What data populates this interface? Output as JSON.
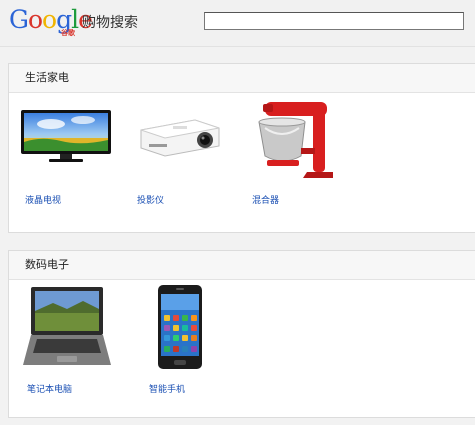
{
  "header": {
    "logo_text": "Google",
    "logo_sub": "谷歌",
    "service_title": "购物搜索",
    "search_value": ""
  },
  "sections": [
    {
      "title": "生活家电",
      "items": [
        {
          "label": "液晶电视",
          "icon": "lcd-tv-icon"
        },
        {
          "label": "投影仪",
          "icon": "projector-icon"
        },
        {
          "label": "混合器",
          "icon": "stand-mixer-icon"
        }
      ]
    },
    {
      "title": "数码电子",
      "items": [
        {
          "label": "笔记本电脑",
          "icon": "laptop-icon"
        },
        {
          "label": "智能手机",
          "icon": "smartphone-icon"
        }
      ]
    }
  ],
  "colors": {
    "link": "#1a4fb3",
    "mixer_red": "#d81f1f",
    "google_blue": "#2b64d6",
    "google_red": "#d9342b",
    "google_yellow": "#f0b400",
    "google_green": "#1e9b3c"
  }
}
